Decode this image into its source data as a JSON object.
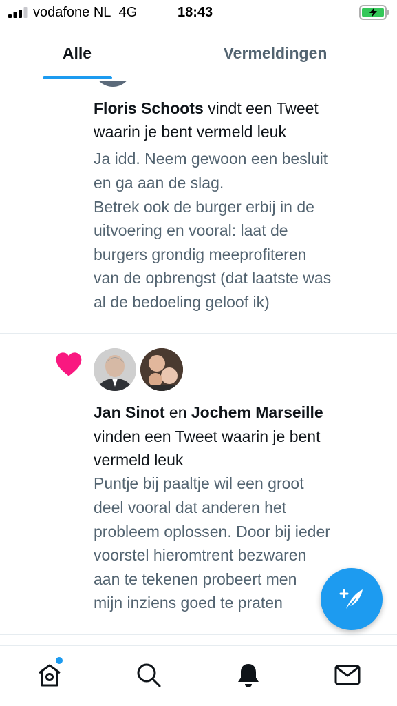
{
  "status_bar": {
    "carrier": "vodafone NL",
    "network": "4G",
    "time": "18:43",
    "battery_color": "#34c759"
  },
  "tabs": [
    {
      "label": "Alle",
      "active": true
    },
    {
      "label": "Vermeldingen",
      "active": false
    }
  ],
  "accent_color": "#1d9bf0",
  "notifications": [
    {
      "icon": "heart-icon",
      "headline_name": "Floris Schoots",
      "headline_rest_1": " vindt een Tweet",
      "headline_rest_2": "waarin je bent vermeld leuk",
      "snippet_lines": [
        "Ja idd. Neem gewoon een besluit",
        "en ga aan de slag.",
        "Betrek ook de burger erbij in de",
        "uitvoering en vooral: laat de",
        "burgers grondig meeprofiteren",
        "van de opbrengst (dat laatste was",
        "al de bedoeling geloof ik)"
      ]
    },
    {
      "icon": "heart-icon",
      "headline_name_1": "Jan Sinot",
      "headline_joiner": " en ",
      "headline_name_2": "Jochem Marseille",
      "headline_rest_1": "vinden een Tweet waarin je bent",
      "headline_rest_2": "vermeld leuk",
      "snippet_lines": [
        "Puntje bij paaltje wil een groot",
        "deel vooral dat anderen het",
        "probleem oplossen. Door bij ieder",
        "voorstel hieromtrent bezwaren",
        "aan te tekenen probeert men",
        "mijn inziens goed te praten"
      ]
    }
  ],
  "fab": {
    "icon": "compose-tweet-icon"
  },
  "bottom_nav": [
    {
      "icon": "home-icon",
      "has_badge": true
    },
    {
      "icon": "search-icon"
    },
    {
      "icon": "bell-icon"
    },
    {
      "icon": "mail-icon"
    }
  ]
}
